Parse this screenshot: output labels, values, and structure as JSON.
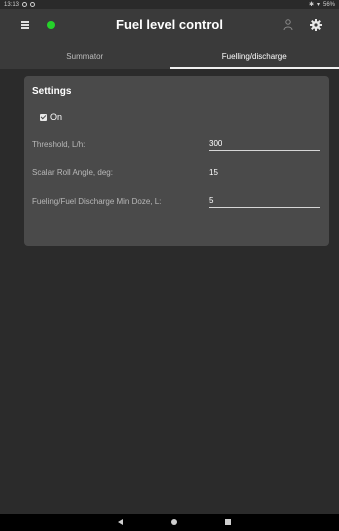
{
  "status_bar": {
    "time": "13:13",
    "battery": "56%"
  },
  "toolbar": {
    "title": "Fuel level control",
    "connection_color": "#25d22a"
  },
  "tabs": [
    {
      "label": "Summator",
      "active": false
    },
    {
      "label": "Fuelling/discharge",
      "active": true
    }
  ],
  "settings": {
    "title": "Settings",
    "on_checkbox": {
      "label": "On",
      "checked": true
    },
    "threshold": {
      "label": "Threshold, L/h:",
      "value": "300"
    },
    "roll_angle": {
      "label": "Scalar Roll Angle, deg:",
      "value": "15"
    },
    "min_doze": {
      "label": "Fueling/Fuel Discharge Min Doze, L:",
      "value": "5"
    }
  },
  "icons": {
    "menu": "hamburger-menu-icon",
    "person": "person-icon",
    "settings": "gear-icon",
    "nav_back": "back-triangle-icon",
    "nav_home": "home-circle-icon",
    "nav_recents": "recents-square-icon"
  }
}
